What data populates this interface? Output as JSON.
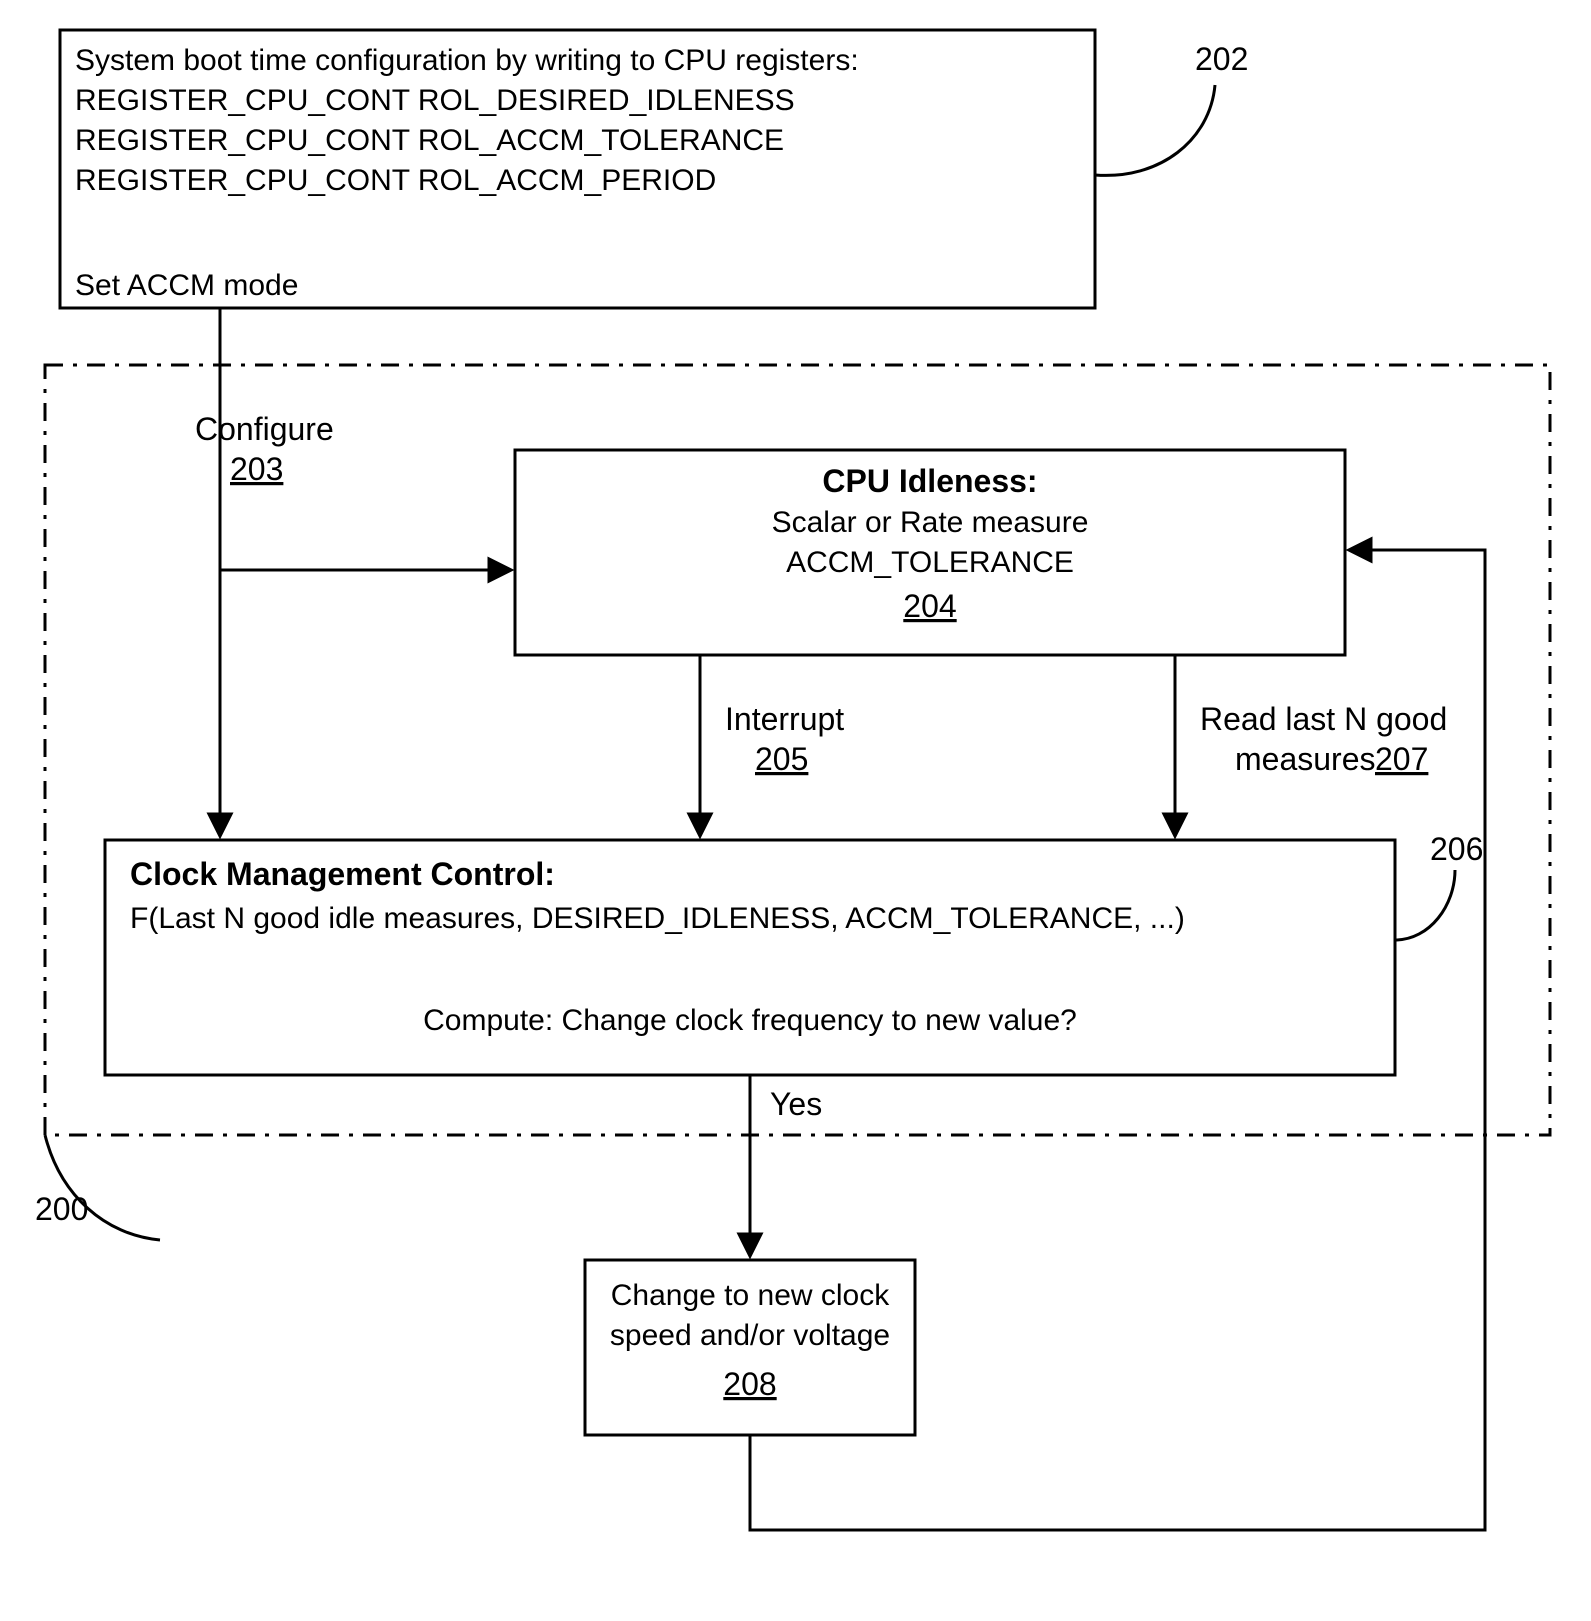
{
  "box202": {
    "line1": "System boot time configuration by writing to CPU registers:",
    "line2": "REGISTER_CPU_CONT ROL_DESIRED_IDLENESS",
    "line3": "REGISTER_CPU_CONT ROL_ACCM_TOLERANCE",
    "line4": "REGISTER_CPU_CONT ROL_ACCM_PERIOD",
    "line5": "Set ACCM mode"
  },
  "label202": "202",
  "label200": "200",
  "configure": {
    "text": "Configure",
    "ref": "203"
  },
  "box204": {
    "title": "CPU Idleness:",
    "l2": "Scalar or Rate measure",
    "l3": "ACCM_TOLERANCE",
    "ref": "204"
  },
  "interrupt": {
    "text": "Interrupt",
    "ref": "205"
  },
  "read": {
    "l1": "Read last N good",
    "l2a": "measures ",
    "ref": "207"
  },
  "box206": {
    "title": "Clock Management Control:",
    "l2": "F(Last N good idle measures,  DESIRED_IDLENESS, ACCM_TOLERANCE, ...)",
    "l3": "Compute:  Change clock frequency to new value?"
  },
  "label206": "206",
  "yes": "Yes",
  "box208": {
    "l1": "Change to new clock",
    "l2": "speed and/or voltage",
    "ref": "208"
  }
}
